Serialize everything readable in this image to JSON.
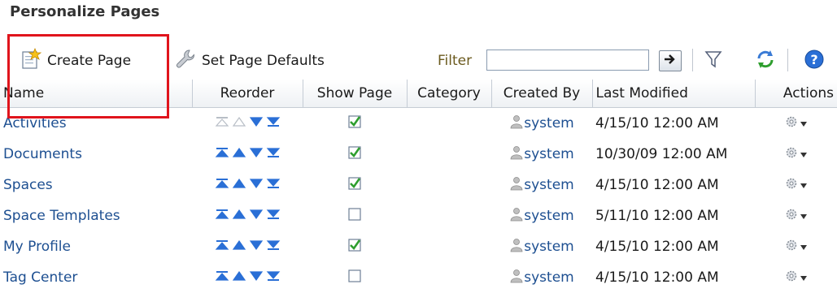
{
  "page": {
    "title": "Personalize Pages"
  },
  "toolbar": {
    "create_label": "Create Page",
    "defaults_label": "Set Page Defaults",
    "filter_label": "Filter",
    "filter_value": "",
    "icons": [
      "create-page-icon",
      "wrench-icon",
      "arrow-right-icon",
      "filter-funnel-icon",
      "refresh-icon",
      "help-icon"
    ]
  },
  "table": {
    "columns": [
      "Name",
      "Reorder",
      "Show Page",
      "Category",
      "Created By",
      "Last Modified",
      "Actions"
    ],
    "rows": [
      {
        "name": "Activities",
        "show_page": true,
        "category": "",
        "created_by": "system",
        "last_modified": "4/15/10 12:00 AM",
        "top_row": true
      },
      {
        "name": "Documents",
        "show_page": true,
        "category": "",
        "created_by": "system",
        "last_modified": "10/30/09 12:00 AM",
        "top_row": false
      },
      {
        "name": "Spaces",
        "show_page": true,
        "category": "",
        "created_by": "system",
        "last_modified": "4/15/10 12:00 AM",
        "top_row": false
      },
      {
        "name": "Space Templates",
        "show_page": false,
        "category": "",
        "created_by": "system",
        "last_modified": "5/11/10 12:00 AM",
        "top_row": false
      },
      {
        "name": "My Profile",
        "show_page": true,
        "category": "",
        "created_by": "system",
        "last_modified": "4/15/10 12:00 AM",
        "top_row": false
      },
      {
        "name": "Tag Center",
        "show_page": false,
        "category": "",
        "created_by": "system",
        "last_modified": "4/15/10 12:00 AM",
        "top_row": false
      }
    ]
  },
  "colors": {
    "highlight": "#e0141c",
    "link": "#1d4f91",
    "arrow_active": "#2a6fd6",
    "arrow_disabled": "#b8bec6",
    "check": "#2e9e2e"
  }
}
